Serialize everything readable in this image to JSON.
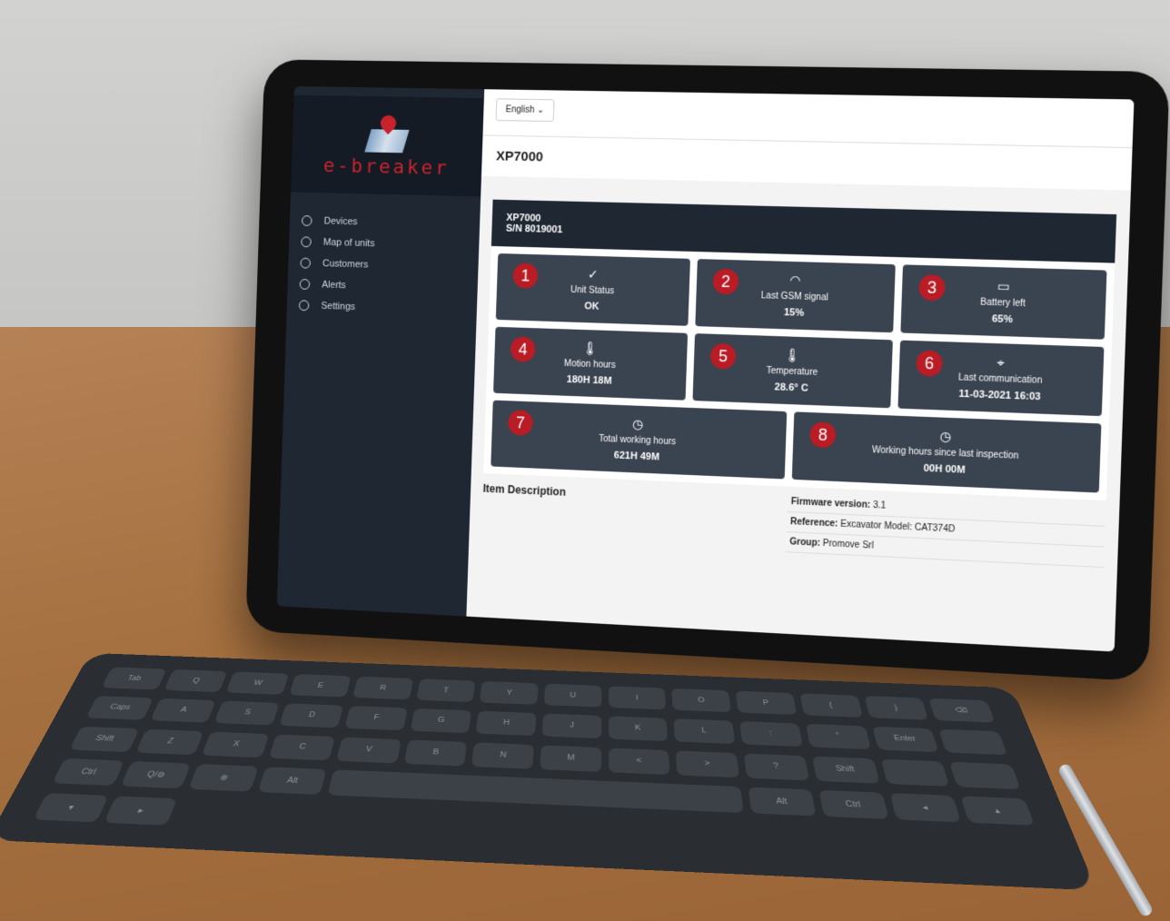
{
  "app": {
    "logo_text": "e-breaker",
    "language": "English ⌄"
  },
  "sidebar": {
    "items": [
      {
        "label": "Devices",
        "icon": "gear-icon"
      },
      {
        "label": "Map of units",
        "icon": "map-pin-icon"
      },
      {
        "label": "Customers",
        "icon": "users-icon"
      },
      {
        "label": "Alerts",
        "icon": "bell-icon"
      },
      {
        "label": "Settings",
        "icon": "settings-icon"
      }
    ]
  },
  "page": {
    "title": "XP7000"
  },
  "device": {
    "model": "XP7000",
    "serial": "S/N 8019001"
  },
  "cards": [
    {
      "badge": "1",
      "icon": "checkmark-icon",
      "label": "Unit Status",
      "value": "OK"
    },
    {
      "badge": "2",
      "icon": "wifi-icon",
      "label": "Last GSM signal",
      "value": "15%"
    },
    {
      "badge": "3",
      "icon": "battery-icon",
      "label": "Battery left",
      "value": "65%"
    },
    {
      "badge": "4",
      "icon": "thermometer-icon",
      "label": "Motion hours",
      "value": "180H 18M"
    },
    {
      "badge": "5",
      "icon": "thermometer-icon",
      "label": "Temperature",
      "value": "28.6° C"
    },
    {
      "badge": "6",
      "icon": "location-icon",
      "label": "Last communication",
      "value": "11-03-2021 16:03"
    },
    {
      "badge": "7",
      "icon": "clock-icon",
      "label": "Total working hours",
      "value": "621H 49M"
    },
    {
      "badge": "8",
      "icon": "clock-icon",
      "label": "Working hours since last inspection",
      "value": "00H 00M"
    }
  ],
  "details": {
    "item_description": "Item Description",
    "firmware_label": "Firmware version:",
    "firmware_value": "3.1",
    "reference_label": "Reference:",
    "reference_value": "Excavator Model: CAT374D",
    "group_label": "Group:",
    "group_value": "Promove Srl"
  },
  "keyboard": {
    "keys": [
      "Tab",
      "Q",
      "W",
      "E",
      "R",
      "T",
      "Y",
      "U",
      "I",
      "O",
      "P",
      "{",
      "}",
      "⌫",
      "Caps",
      "A",
      "S",
      "D",
      "F",
      "G",
      "H",
      "J",
      "K",
      "L",
      ":",
      "\"",
      "Enter",
      "",
      "Shift",
      "Z",
      "X",
      "C",
      "V",
      "B",
      "N",
      "M",
      "<",
      ">",
      "?",
      "Shift",
      "",
      ""
    ],
    "bottom": [
      "Ctrl",
      "Q/⚙",
      "⊕",
      "Alt",
      "",
      "Alt",
      "Ctrl",
      "◂",
      "▴",
      "▾",
      "▸"
    ]
  }
}
